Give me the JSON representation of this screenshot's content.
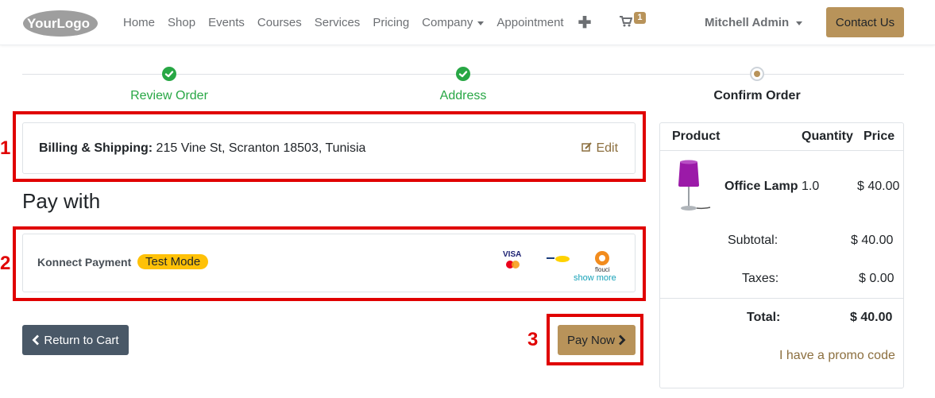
{
  "header": {
    "logo_text": "YourLogo",
    "nav": [
      {
        "label": "Home"
      },
      {
        "label": "Shop"
      },
      {
        "label": "Events"
      },
      {
        "label": "Courses"
      },
      {
        "label": "Services"
      },
      {
        "label": "Pricing"
      },
      {
        "label": "Company",
        "dropdown": true
      },
      {
        "label": "Appointment"
      }
    ],
    "cart_count": "1",
    "user_name": "Mitchell Admin",
    "contact_label": "Contact Us"
  },
  "steps": [
    {
      "label": "Review Order",
      "state": "done"
    },
    {
      "label": "Address",
      "state": "done"
    },
    {
      "label": "Confirm Order",
      "state": "current"
    }
  ],
  "annotations": [
    "1",
    "2",
    "3"
  ],
  "billing": {
    "label": "Billing & Shipping:",
    "address": "215 Vine St, Scranton 18503, Tunisia",
    "edit_label": "Edit"
  },
  "pay_with_title": "Pay with",
  "payment": {
    "name": "Konnect Payment",
    "badge": "Test Mode",
    "icons": [
      "visa-mastercard-icon",
      "edinar-icon",
      "flouci-icon"
    ],
    "icon_texts": {
      "visa": "VISA",
      "flouci": "flouci"
    },
    "show_more": "show more"
  },
  "actions": {
    "return_label": "Return to Cart",
    "pay_now_label": "Pay Now"
  },
  "summary": {
    "headers": {
      "product": "Product",
      "quantity": "Quantity",
      "price": "Price"
    },
    "item": {
      "name": "Office Lamp",
      "quantity": "1.0",
      "price": "$ 40.00"
    },
    "subtotal_label": "Subtotal:",
    "subtotal_value": "$ 40.00",
    "taxes_label": "Taxes:",
    "taxes_value": "$ 0.00",
    "total_label": "Total:",
    "total_value": "$ 40.00",
    "promo_label": "I have a promo code"
  },
  "colors": {
    "accent": "#b8935a",
    "success": "#28a745",
    "annotation": "#e00000",
    "badge": "#ffc107",
    "secondary_button": "#495867"
  }
}
